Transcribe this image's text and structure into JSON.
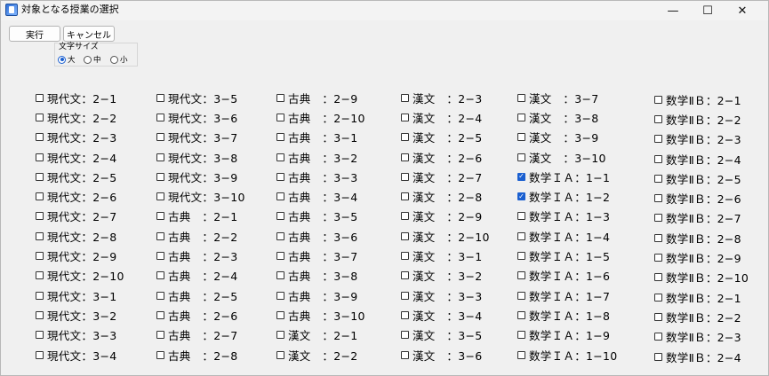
{
  "window": {
    "title": "対象となる授業の選択",
    "controls": {
      "minimize": "—",
      "maximize": "☐",
      "close": "✕"
    }
  },
  "toolbar": {
    "run_label": "実行",
    "cancel_label": "キャンセル"
  },
  "font_size": {
    "label": "文字サイズ",
    "options": [
      {
        "label": "大",
        "selected": true
      },
      {
        "label": "中",
        "selected": false
      },
      {
        "label": "小",
        "selected": false
      }
    ]
  },
  "columns": [
    {
      "items": [
        {
          "label": "現代文：2−1",
          "checked": false
        },
        {
          "label": "現代文：2−2",
          "checked": false
        },
        {
          "label": "現代文：2−3",
          "checked": false
        },
        {
          "label": "現代文：2−4",
          "checked": false
        },
        {
          "label": "現代文：2−5",
          "checked": false
        },
        {
          "label": "現代文：2−6",
          "checked": false
        },
        {
          "label": "現代文：2−7",
          "checked": false
        },
        {
          "label": "現代文：2−8",
          "checked": false
        },
        {
          "label": "現代文：2−9",
          "checked": false
        },
        {
          "label": "現代文：2−10",
          "checked": false
        },
        {
          "label": "現代文：3−1",
          "checked": false
        },
        {
          "label": "現代文：3−2",
          "checked": false
        },
        {
          "label": "現代文：3−3",
          "checked": false
        },
        {
          "label": "現代文：3−4",
          "checked": false
        }
      ]
    },
    {
      "items": [
        {
          "label": "現代文：3−5",
          "checked": false
        },
        {
          "label": "現代文：3−6",
          "checked": false
        },
        {
          "label": "現代文：3−7",
          "checked": false
        },
        {
          "label": "現代文：3−8",
          "checked": false
        },
        {
          "label": "現代文：3−9",
          "checked": false
        },
        {
          "label": "現代文：3−10",
          "checked": false
        },
        {
          "label": "古典　：2−1",
          "checked": false
        },
        {
          "label": "古典　：2−2",
          "checked": false
        },
        {
          "label": "古典　：2−3",
          "checked": false
        },
        {
          "label": "古典　：2−4",
          "checked": false
        },
        {
          "label": "古典　：2−5",
          "checked": false
        },
        {
          "label": "古典　：2−6",
          "checked": false
        },
        {
          "label": "古典　：2−7",
          "checked": false
        },
        {
          "label": "古典　：2−8",
          "checked": false
        }
      ]
    },
    {
      "items": [
        {
          "label": "古典　：2−9",
          "checked": false
        },
        {
          "label": "古典　：2−10",
          "checked": false
        },
        {
          "label": "古典　：3−1",
          "checked": false
        },
        {
          "label": "古典　：3−2",
          "checked": false
        },
        {
          "label": "古典　：3−3",
          "checked": false
        },
        {
          "label": "古典　：3−4",
          "checked": false
        },
        {
          "label": "古典　：3−5",
          "checked": false
        },
        {
          "label": "古典　：3−6",
          "checked": false
        },
        {
          "label": "古典　：3−7",
          "checked": false
        },
        {
          "label": "古典　：3−8",
          "checked": false
        },
        {
          "label": "古典　：3−9",
          "checked": false
        },
        {
          "label": "古典　：3−10",
          "checked": false
        },
        {
          "label": "漢文　：2−1",
          "checked": false
        },
        {
          "label": "漢文　：2−2",
          "checked": false
        }
      ]
    },
    {
      "items": [
        {
          "label": "漢文　：2−3",
          "checked": false
        },
        {
          "label": "漢文　：2−4",
          "checked": false
        },
        {
          "label": "漢文　：2−5",
          "checked": false
        },
        {
          "label": "漢文　：2−6",
          "checked": false
        },
        {
          "label": "漢文　：2−7",
          "checked": false
        },
        {
          "label": "漢文　：2−8",
          "checked": false
        },
        {
          "label": "漢文　：2−9",
          "checked": false
        },
        {
          "label": "漢文　：2−10",
          "checked": false
        },
        {
          "label": "漢文　：3−1",
          "checked": false
        },
        {
          "label": "漢文　：3−2",
          "checked": false
        },
        {
          "label": "漢文　：3−3",
          "checked": false
        },
        {
          "label": "漢文　：3−4",
          "checked": false
        },
        {
          "label": "漢文　：3−5",
          "checked": false
        },
        {
          "label": "漢文　：3−6",
          "checked": false
        }
      ]
    },
    {
      "items": [
        {
          "label": "漢文　：3−7",
          "checked": false
        },
        {
          "label": "漢文　：3−8",
          "checked": false
        },
        {
          "label": "漢文　：3−9",
          "checked": false
        },
        {
          "label": "漢文　：3−10",
          "checked": false
        },
        {
          "label": "数学ＩＡ：1−1",
          "checked": true
        },
        {
          "label": "数学ＩＡ：1−2",
          "checked": true
        },
        {
          "label": "数学ＩＡ：1−3",
          "checked": false
        },
        {
          "label": "数学ＩＡ：1−4",
          "checked": false
        },
        {
          "label": "数学ＩＡ：1−5",
          "checked": false
        },
        {
          "label": "数学ＩＡ：1−6",
          "checked": false
        },
        {
          "label": "数学ＩＡ：1−7",
          "checked": false
        },
        {
          "label": "数学ＩＡ：1−8",
          "checked": false
        },
        {
          "label": "数学ＩＡ：1−9",
          "checked": false
        },
        {
          "label": "数学ＩＡ：1−10",
          "checked": false
        }
      ]
    },
    {
      "items": [
        {
          "label": "数学ⅡＢ：2−1",
          "checked": false
        },
        {
          "label": "数学ⅡＢ：2−2",
          "checked": false
        },
        {
          "label": "数学ⅡＢ：2−3",
          "checked": false
        },
        {
          "label": "数学ⅡＢ：2−4",
          "checked": false
        },
        {
          "label": "数学ⅡＢ：2−5",
          "checked": false
        },
        {
          "label": "数学ⅡＢ：2−6",
          "checked": false
        },
        {
          "label": "数学ⅡＢ：2−7",
          "checked": false
        },
        {
          "label": "数学ⅡＢ：2−8",
          "checked": false
        },
        {
          "label": "数学ⅡＢ：2−9",
          "checked": false
        },
        {
          "label": "数学ⅡＢ：2−10",
          "checked": false
        },
        {
          "label": "数学ⅡＢ：2−1",
          "checked": false
        },
        {
          "label": "数学ⅡＢ：2−2",
          "checked": false
        },
        {
          "label": "数学ⅡＢ：2−3",
          "checked": false
        },
        {
          "label": "数学ⅡＢ：2−4",
          "checked": false
        }
      ]
    }
  ]
}
